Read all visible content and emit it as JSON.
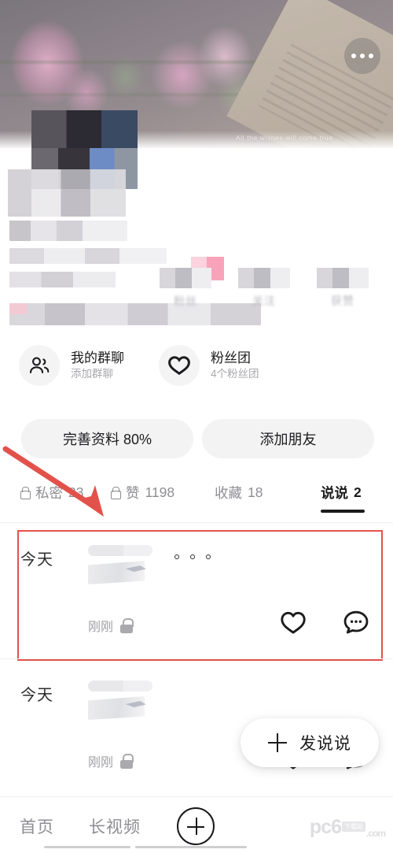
{
  "cover": {
    "caption": "All the wishes will come true",
    "more_icon": "more-horizontal-icon"
  },
  "profile": {
    "censored": true,
    "stats": [
      {
        "label": "粉丝",
        "value": ""
      },
      {
        "label": "关注",
        "value": ""
      },
      {
        "label": "获赞",
        "value": ""
      }
    ]
  },
  "entries": [
    {
      "icon": "group-people-icon",
      "title": "我的群聊",
      "subtitle": "添加群聊"
    },
    {
      "icon": "heart-fanclub-icon",
      "title": "粉丝团",
      "subtitle": "4个粉丝团"
    }
  ],
  "actions": {
    "primary": "完善资料 80%",
    "secondary": "添加朋友"
  },
  "tabs": [
    {
      "label": "私密",
      "count": "23",
      "locked": true,
      "active": false
    },
    {
      "label": "赞",
      "count": "1198",
      "locked": true,
      "active": false
    },
    {
      "label": "收藏",
      "count": "18",
      "locked": false,
      "active": false
    },
    {
      "label": "说说",
      "count": "2",
      "locked": false,
      "active": true
    }
  ],
  "feed": [
    {
      "date": "今天",
      "time": "刚刚",
      "privacy_icon": "lock-icon",
      "content_censored": true,
      "more_icon": "three-dots-icon",
      "like_icon": "heart-outline-icon",
      "comment_icon": "comment-bubble-icon",
      "highlighted": true
    },
    {
      "date": "今天",
      "time": "刚刚",
      "privacy_icon": "lock-icon",
      "content_censored": true,
      "more_icon": "three-dots-icon",
      "like_icon": "heart-outline-icon",
      "comment_icon": "comment-bubble-icon",
      "highlighted": false
    }
  ],
  "fab": {
    "label": "发说说",
    "icon": "plus-icon"
  },
  "bottom_nav": {
    "items": [
      {
        "label": "首页",
        "active": false
      },
      {
        "label": "长视频",
        "active": false
      }
    ],
    "center_icon": "plus-circle-icon"
  },
  "watermark": {
    "text": "pc6",
    "suffix": ".com",
    "badge": "下载站"
  },
  "annotation": {
    "type": "red-arrow-and-box",
    "color": "#e2524b",
    "target": "first-post-card"
  }
}
